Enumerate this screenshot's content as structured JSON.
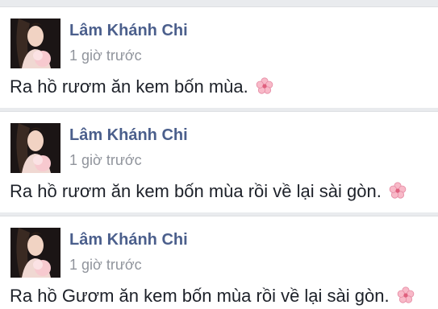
{
  "posts": [
    {
      "author": "Lâm Khánh Chi",
      "time": "1 giờ trước",
      "message": "Ra hồ rươm ăn kem bốn mùa.",
      "emoji_icon": "cherry-blossom-icon"
    },
    {
      "author": "Lâm Khánh Chi",
      "time": "1 giờ trước",
      "message": "Ra hồ rươm ăn kem bốn mùa rồi về lại sài gòn.",
      "emoji_icon": "cherry-blossom-icon"
    },
    {
      "author": "Lâm Khánh Chi",
      "time": "1 giờ trước",
      "message": "Ra hồ Gươm ăn kem bốn mùa rồi về lại sài gòn.",
      "emoji_icon": "cherry-blossom-icon"
    }
  ],
  "colors": {
    "author_name": "#4b5f8c",
    "timestamp": "#90949c",
    "message_text": "#1d2129",
    "feed_background": "#e9ebee"
  }
}
